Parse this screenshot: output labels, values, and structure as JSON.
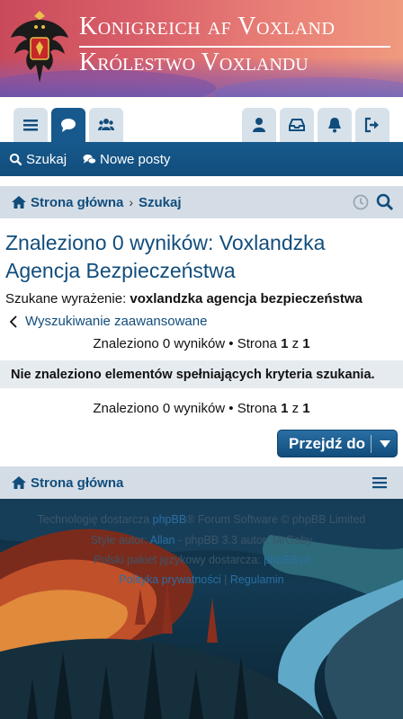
{
  "banner": {
    "line1": "Konigreich af Voxland",
    "line2": "Królestwo Voxlandu",
    "crest_icon": "eagle-crest-icon"
  },
  "iconbar": {
    "left": [
      "menu-icon",
      "chat-icon",
      "users-icon"
    ],
    "right": [
      "user-icon",
      "inbox-icon",
      "bell-icon",
      "logout-icon"
    ],
    "active": "chat-icon"
  },
  "navbar": {
    "search_label": "Szukaj",
    "new_posts_label": "Nowe posty"
  },
  "breadcrumb": {
    "home": "Strona główna",
    "current": "Szukaj"
  },
  "main": {
    "title": "Znaleziono 0 wyników: Voxlandzka Agencja Bezpieczeństwa",
    "query_label": "Szukane wyrażenie:",
    "query_value": "voxlandzka agencja bezpieczeństwa",
    "advanced_link": "Wyszukiwanie zaawansowane",
    "pager_prefix": "Znaleziono 0 wyników • Strona",
    "pager_page": "1",
    "pager_of": "z",
    "pager_total": "1",
    "no_results": "Nie znaleziono elementów spełniających kryteria szukania.",
    "jump_label": "Przejdź do"
  },
  "bottom_nav": {
    "home": "Strona główna"
  },
  "footer": {
    "line1_pre": "Technologię dostarcza",
    "line1_link": "phpBB",
    "line1_post": "® Forum Software © phpBB Limited",
    "line2_pre": "Style autor:",
    "line2_link": "Allan",
    "line2_post": "- phpBB 3.3 autor: MrGaby",
    "line3_pre": "Polski pakiet językowy dostarcza:",
    "line3_link": "phpBB.pl",
    "line4_link1": "Polityka prywatności",
    "line4_sep": "|",
    "line4_link2": "Regulamin"
  },
  "colors": {
    "primary": "#114d7c",
    "banner": "#d9606a",
    "tab_bg": "#d7e1ea"
  }
}
